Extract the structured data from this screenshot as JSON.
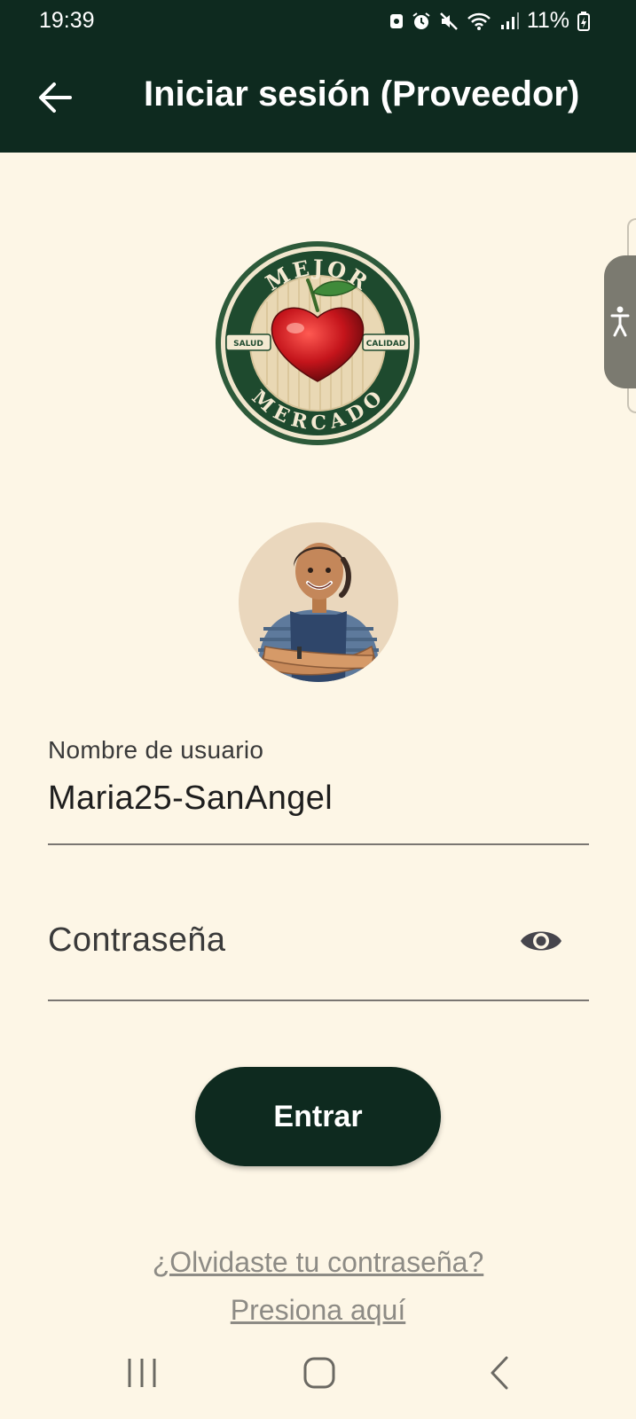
{
  "status_bar": {
    "time": "19:39",
    "battery_percent": "11%",
    "icons": [
      "notification-icon",
      "alarm-icon",
      "mute-icon",
      "wifi-icon",
      "signal-icon",
      "battery-icon"
    ]
  },
  "header": {
    "title": "Iniciar sesión (Proveedor)",
    "back_icon": "arrow-left-icon"
  },
  "logo": {
    "top_text": "MEJOR",
    "bottom_text": "MERCADO",
    "left_badge": "SALUD",
    "right_badge": "CALIDAD"
  },
  "form": {
    "username_label": "Nombre de usuario",
    "username_value": "Maria25-SanAngel",
    "password_placeholder": "Contraseña",
    "password_value": "",
    "submit_label": "Entrar"
  },
  "forgot": {
    "question": "¿Olvidaste tu contraseña?",
    "link": "Presiona aquí"
  },
  "colors": {
    "primary_dark": "#0e2a1f",
    "background": "#fdf6e6",
    "link_gray": "#8d8b85"
  }
}
